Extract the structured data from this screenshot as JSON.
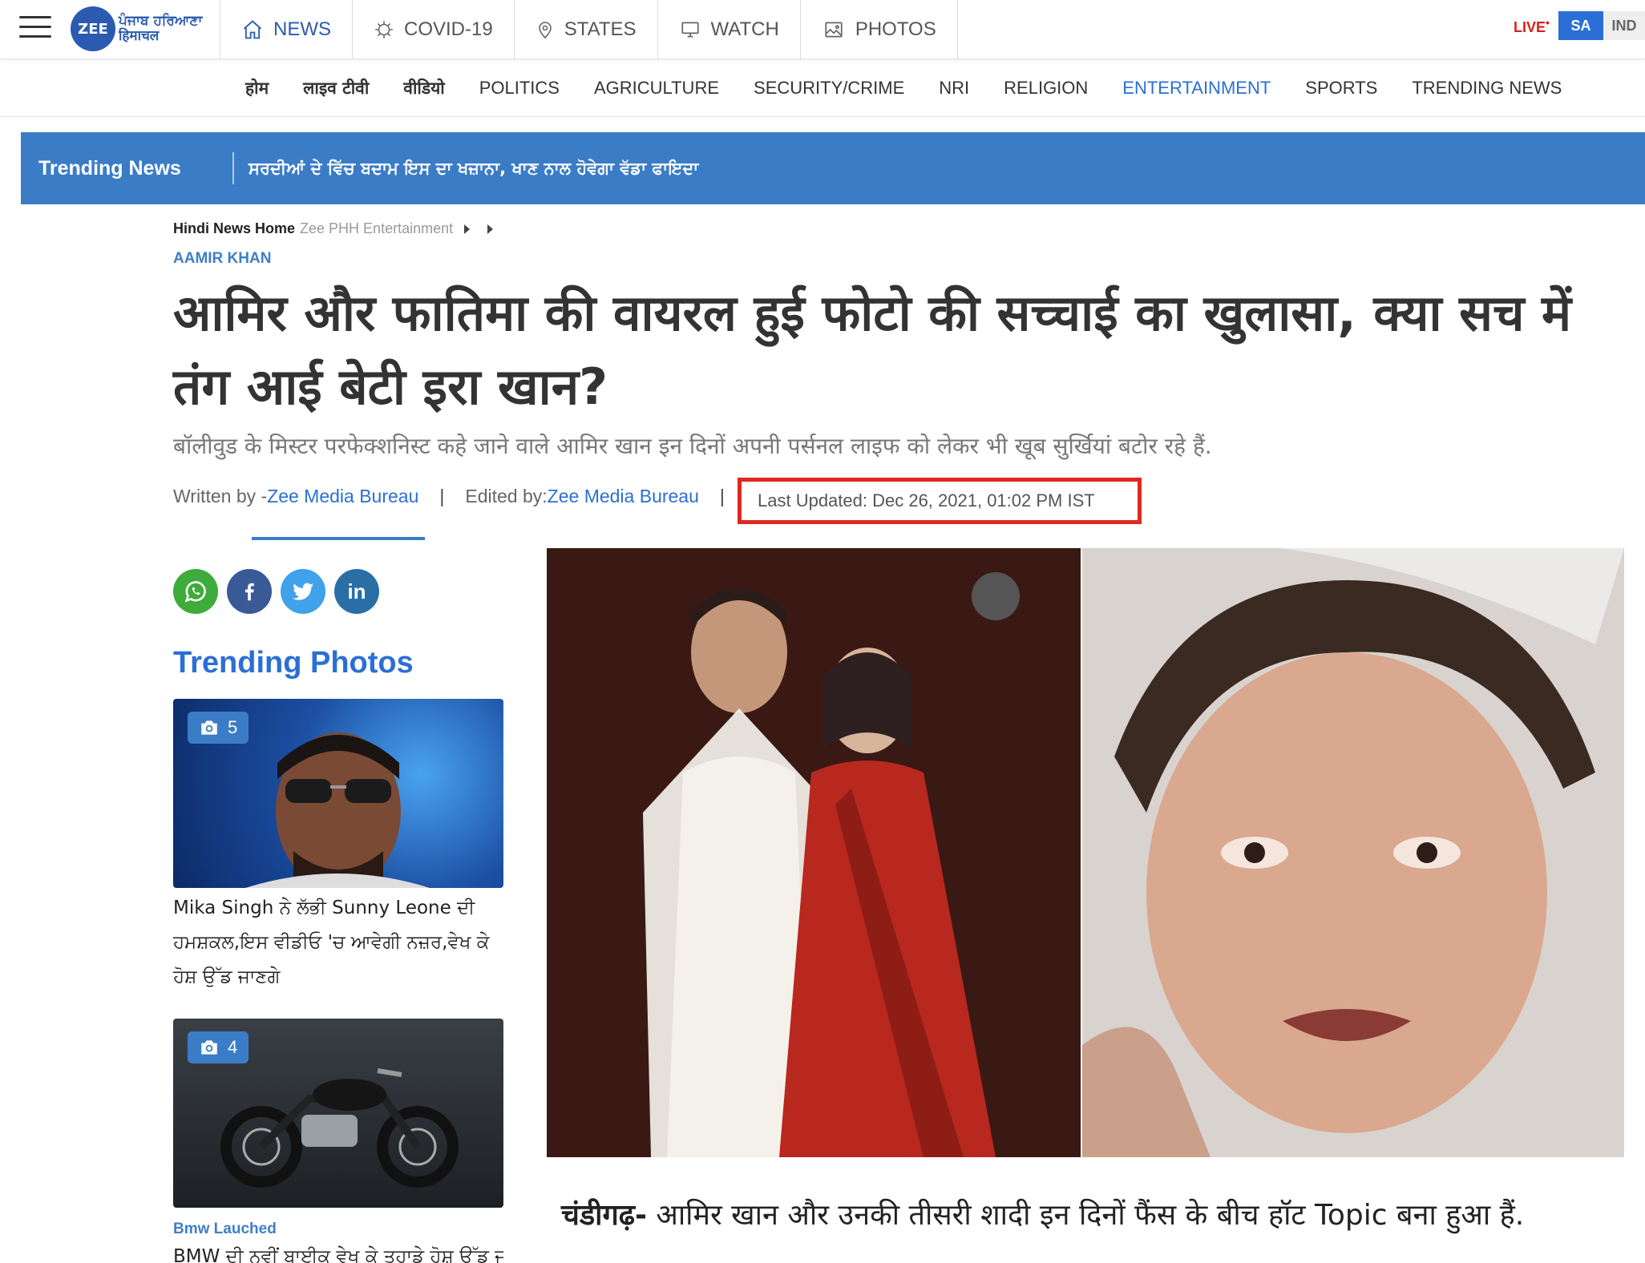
{
  "header": {
    "logo_badge": "ZEE",
    "logo_line1": "ਪੰਜਾਬ ਹਰਿਆਣਾ",
    "logo_line2": "हिमाचल",
    "main_nav": [
      {
        "label": "NEWS",
        "icon": "home-icon",
        "active": true
      },
      {
        "label": "COVID-19",
        "icon": "virus-icon",
        "active": false
      },
      {
        "label": "STATES",
        "icon": "location-pin-icon",
        "active": false
      },
      {
        "label": "WATCH",
        "icon": "monitor-icon",
        "active": false
      },
      {
        "label": "PHOTOS",
        "icon": "image-icon",
        "active": false
      }
    ],
    "live_label": "LIVE",
    "lang_active": "SA",
    "lang_other": "IND",
    "accent_color": "#2b6fd6",
    "live_color": "#d8201c"
  },
  "subnav": [
    {
      "label": "होम",
      "devanagari": true
    },
    {
      "label": "लाइव टीवी",
      "devanagari": true
    },
    {
      "label": "वीडियो",
      "devanagari": true
    },
    {
      "label": "POLITICS"
    },
    {
      "label": "AGRICULTURE"
    },
    {
      "label": "SECURITY/CRIME"
    },
    {
      "label": "NRI"
    },
    {
      "label": "RELIGION"
    },
    {
      "label": "ENTERTAINMENT",
      "active": true
    },
    {
      "label": "SPORTS"
    },
    {
      "label": "TRENDING NEWS"
    }
  ],
  "trending_bar": {
    "label": "Trending News",
    "headline": "ਸਰਦੀਆਂ ਦੇ ਵਿੱਚ ਬਦਾਮ ਇਸ ਦਾ ਖਜ਼ਾਨਾ, ਖਾਣ ਨਾਲ ਹੋਵੇਗਾ ਵੱਡਾ ਫਾਇਦਾ"
  },
  "breadcrumb": {
    "home": "Hindi News Home",
    "section": "Zee PHH Entertainment"
  },
  "article": {
    "category": "AAMIR KHAN",
    "headline": "आमिर और फातिमा की वायरल हुई फोटो की सच्चाई का खुलासा, क्या सच में तंग आई बेटी इरा खान?",
    "subtitle": "बॉलीवुड के मिस्टर परफेक्शनिस्ट कहे जाने वाले आमिर खान इन दिनों अपनी पर्सनल लाइफ को लेकर भी खूब सुर्खियां बटोर रहे हैं.",
    "written_by_label": "Written by - ",
    "written_by": "Zee Media Bureau",
    "edited_by_label": "Edited by: ",
    "edited_by": "Zee Media Bureau",
    "last_updated": "Last Updated: Dec 26, 2021, 01:02 PM IST",
    "body_lead": "चंडीगढ़-",
    "body_text": " आमिर खान और उनकी तीसरी शादी इन दिनों फैंस के बीच हॉट Topic बना हुआ हैं."
  },
  "share": [
    "whatsapp-icon",
    "facebook-icon",
    "twitter-icon",
    "linkedin-icon"
  ],
  "trending_photos": {
    "heading": "Trending Photos",
    "cards": [
      {
        "count": "5",
        "caption": "Mika Singh ਨੇ ਲੱਭੀ Sunny Leone ਦੀ ਹਮਸ਼ਕਲ,ਇਸ ਵੀਡੀਓ 'ਚ ਆਵੇਗੀ ਨਜ਼ਰ,ਵੇਖ ਕੇ ਹੋਸ਼ ਉੱਡ ਜਾਣਗੇ",
        "tag": ""
      },
      {
        "count": "4",
        "caption": "BMW ਦੀ ਨਵੀਂ ਬਾਈਕ ਵੇਖ ਕੇ ਤੁਹਾਡੇ ਹੋਸ਼ ਉੱਡ ਜਾਣਗੇ",
        "tag": "Bmw Lauched"
      }
    ]
  }
}
